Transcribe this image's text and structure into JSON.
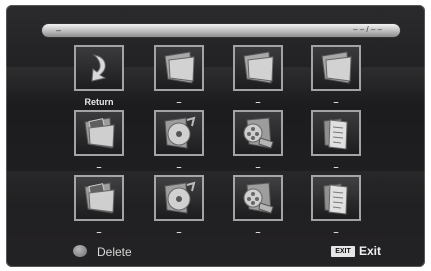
{
  "progress": {
    "left_text": "–",
    "right_text": "– – / – –"
  },
  "grid": {
    "row1": [
      {
        "label": "Return",
        "icon": "return-arrow-icon"
      },
      {
        "label": "–",
        "icon": "folder-icon"
      },
      {
        "label": "–",
        "icon": "folder-icon"
      },
      {
        "label": "–",
        "icon": "folder-icon"
      }
    ],
    "row2": [
      {
        "label": "–",
        "icon": "photo-folder-icon"
      },
      {
        "label": "–",
        "icon": "music-disc-icon"
      },
      {
        "label": "–",
        "icon": "movie-reel-icon"
      },
      {
        "label": "–",
        "icon": "document-icon"
      }
    ],
    "row3": [
      {
        "label": "–",
        "icon": "photo-folder-icon"
      },
      {
        "label": "–",
        "icon": "music-disc-icon"
      },
      {
        "label": "–",
        "icon": "movie-reel-icon"
      },
      {
        "label": "–",
        "icon": "document-icon"
      }
    ]
  },
  "footer": {
    "delete_label": "Delete",
    "exit_key_label": "EXIT",
    "exit_label": "Exit"
  },
  "colors": {
    "background": "#1f1e20",
    "tile_border": "#a3a3a3",
    "progress_bar": "#bdbdbd"
  }
}
